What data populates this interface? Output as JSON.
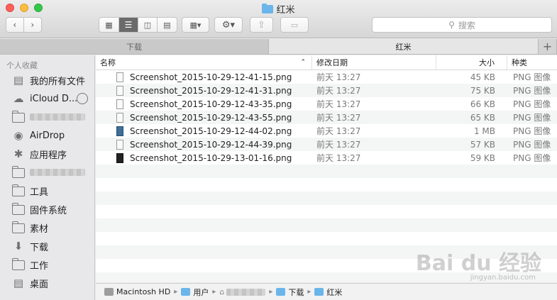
{
  "window": {
    "title": "红米"
  },
  "toolbar": {
    "back_icon": "chevron-left-icon",
    "forward_icon": "chevron-right-icon",
    "view_modes": [
      "icon-view",
      "list-view",
      "column-view",
      "coverflow-view"
    ],
    "active_view": "list-view",
    "search_placeholder": "搜索"
  },
  "tabs": [
    {
      "label": "下载",
      "active": false
    },
    {
      "label": "红米",
      "active": true
    }
  ],
  "tab_add": "+",
  "sidebar": {
    "section_title": "个人收藏",
    "items": [
      {
        "label": "我的所有文件",
        "icon": "all-files-icon"
      },
      {
        "label": "iCloud D...",
        "icon": "cloud-icon"
      },
      {
        "label": "",
        "icon": "folder-icon",
        "redacted": true
      },
      {
        "label": "AirDrop",
        "icon": "airdrop-icon"
      },
      {
        "label": "应用程序",
        "icon": "applications-icon"
      },
      {
        "label": "",
        "icon": "folder-icon",
        "redacted": true
      },
      {
        "label": "工具",
        "icon": "folder-icon"
      },
      {
        "label": "固件系统",
        "icon": "folder-icon"
      },
      {
        "label": "素材",
        "icon": "folder-icon"
      },
      {
        "label": "下载",
        "icon": "download-icon"
      },
      {
        "label": "工作",
        "icon": "folder-icon"
      },
      {
        "label": "桌面",
        "icon": "desktop-icon"
      }
    ]
  },
  "columns": {
    "name": "名称",
    "date": "修改日期",
    "size": "大小",
    "kind": "种类"
  },
  "files": [
    {
      "name": "Screenshot_2015-10-29-12-41-15.png",
      "date": "前天 13:27",
      "size": "45 KB",
      "kind": "PNG 图像",
      "thumb": "light"
    },
    {
      "name": "Screenshot_2015-10-29-12-41-31.png",
      "date": "前天 13:27",
      "size": "75 KB",
      "kind": "PNG 图像",
      "thumb": "light"
    },
    {
      "name": "Screenshot_2015-10-29-12-43-35.png",
      "date": "前天 13:27",
      "size": "66 KB",
      "kind": "PNG 图像",
      "thumb": "light"
    },
    {
      "name": "Screenshot_2015-10-29-12-43-55.png",
      "date": "前天 13:27",
      "size": "65 KB",
      "kind": "PNG 图像",
      "thumb": "light"
    },
    {
      "name": "Screenshot_2015-10-29-12-44-02.png",
      "date": "前天 13:27",
      "size": "1 MB",
      "kind": "PNG 图像",
      "thumb": "dark"
    },
    {
      "name": "Screenshot_2015-10-29-12-44-39.png",
      "date": "前天 13:27",
      "size": "57 KB",
      "kind": "PNG 图像",
      "thumb": "light"
    },
    {
      "name": "Screenshot_2015-10-29-13-01-16.png",
      "date": "前天 13:27",
      "size": "59 KB",
      "kind": "PNG 图像",
      "thumb": "black"
    }
  ],
  "pathbar": [
    {
      "label": "Macintosh HD",
      "icon": "hard-drive-icon"
    },
    {
      "label": "用户",
      "icon": "folder-icon"
    },
    {
      "label": "",
      "icon": "home-icon",
      "redacted": true
    },
    {
      "label": "下载",
      "icon": "download-folder-icon"
    },
    {
      "label": "红米",
      "icon": "folder-icon"
    }
  ],
  "watermark": {
    "text": "Bai du 经验",
    "sub": "jingyan.baidu.com"
  }
}
